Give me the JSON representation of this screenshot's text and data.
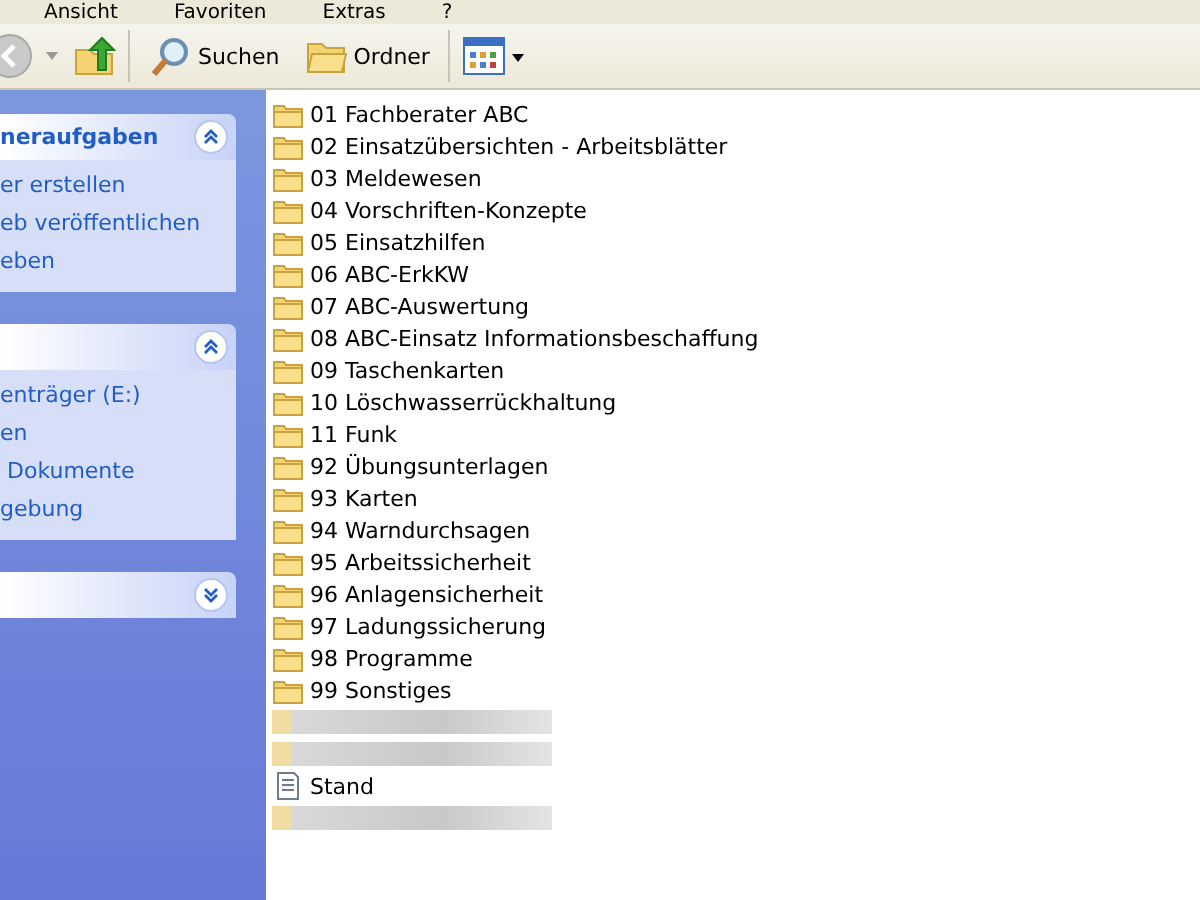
{
  "menu": [
    "Ansicht",
    "Favoriten",
    "Extras",
    "?"
  ],
  "toolbar": {
    "search": "Suchen",
    "folders": "Ordner"
  },
  "task_panes": [
    {
      "title": "neraufgaben",
      "expanded": true,
      "items": [
        "er erstellen",
        "eb veröffentlichen",
        "eben"
      ]
    },
    {
      "expanded": true,
      "items": [
        "enträger (E:)",
        "en",
        " Dokumente",
        "gebung"
      ]
    },
    {
      "expanded": false
    }
  ],
  "files": [
    {
      "kind": "folder",
      "name": "01 Fachberater ABC"
    },
    {
      "kind": "folder",
      "name": "02 Einsatzübersichten - Arbeitsblätter"
    },
    {
      "kind": "folder",
      "name": "03 Meldewesen"
    },
    {
      "kind": "folder",
      "name": "04 Vorschriften-Konzepte"
    },
    {
      "kind": "folder",
      "name": "05 Einsatzhilfen"
    },
    {
      "kind": "folder",
      "name": "06 ABC-ErkKW"
    },
    {
      "kind": "folder",
      "name": "07 ABC-Auswertung"
    },
    {
      "kind": "folder",
      "name": "08 ABC-Einsatz Informationsbeschaffung"
    },
    {
      "kind": "folder",
      "name": "09 Taschenkarten"
    },
    {
      "kind": "folder",
      "name": "10 Löschwasserrückhaltung"
    },
    {
      "kind": "folder",
      "name": "11 Funk"
    },
    {
      "kind": "folder",
      "name": "92 Übungsunterlagen"
    },
    {
      "kind": "folder",
      "name": "93 Karten"
    },
    {
      "kind": "folder",
      "name": "94 Warndurchsagen"
    },
    {
      "kind": "folder",
      "name": "95 Arbeitssicherheit"
    },
    {
      "kind": "folder",
      "name": "96 Anlagensicherheit"
    },
    {
      "kind": "folder",
      "name": "97 Ladungssicherung"
    },
    {
      "kind": "folder",
      "name": "98 Programme"
    },
    {
      "kind": "folder",
      "name": "99 Sonstiges"
    },
    {
      "kind": "blurred"
    },
    {
      "kind": "blurred"
    },
    {
      "kind": "document",
      "name": "Stand"
    },
    {
      "kind": "blurred"
    }
  ]
}
